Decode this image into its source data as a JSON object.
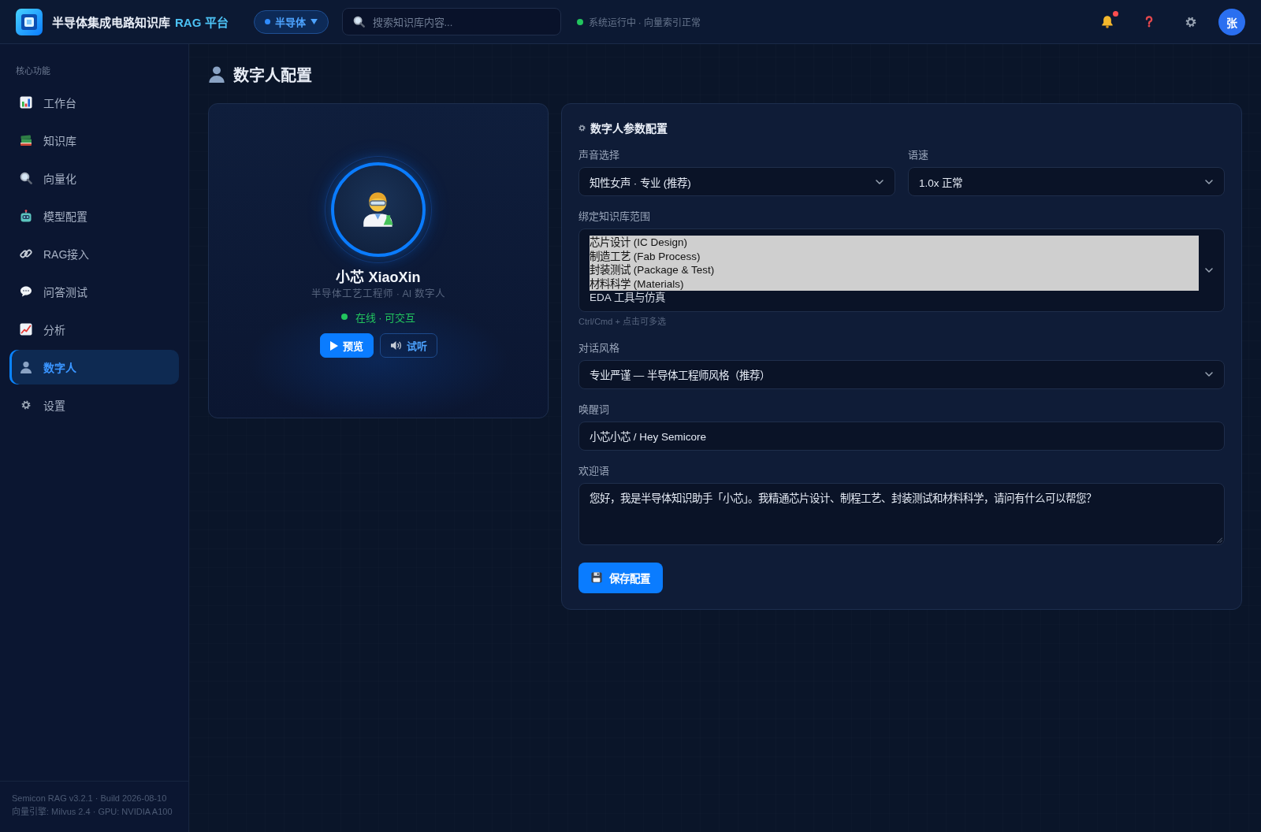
{
  "topbar": {
    "brand": {
      "name": "半导体集成电路知识库",
      "accent": "RAG 平台"
    },
    "domain": {
      "label": "半导体"
    },
    "search": {
      "placeholder": "搜索知识库内容..."
    },
    "status": {
      "ok": true,
      "text": "系统运行中 · 向量索引正常"
    },
    "notifications": {
      "unread": true
    },
    "user": {
      "initial": "张"
    }
  },
  "sidebar": {
    "section": "核心功能",
    "items": [
      {
        "label": "工作台",
        "selected": false
      },
      {
        "label": "知识库",
        "selected": false
      },
      {
        "label": "向量化",
        "selected": false
      },
      {
        "label": "模型配置",
        "selected": false
      },
      {
        "label": "RAG接入",
        "selected": false
      },
      {
        "label": "问答测试",
        "selected": false
      },
      {
        "label": "分析",
        "selected": false
      },
      {
        "label": "数字人",
        "selected": true
      },
      {
        "label": "设置",
        "selected": false
      }
    ],
    "footer": [
      "Semicon RAG v3.2.1 · Build 2026-08-10",
      "向量引擎: Milvus 2.4 · GPU: NVIDIA A100"
    ]
  },
  "page": {
    "title": "数字人配置"
  },
  "avatar_card": {
    "name": "小芯 XiaoXin",
    "role": "半导体工艺工程师 · AI 数字人",
    "status": {
      "online": true,
      "text": "在线 · 可交互"
    },
    "buttons": [
      {
        "label": "预览",
        "kind": "primary"
      },
      {
        "label": "试听",
        "kind": "outline"
      }
    ]
  },
  "config": {
    "title": "数字人参数配置",
    "rows": [
      [
        {
          "kind": "select",
          "label": "声音选择",
          "value": "知性女声 · 专业 (推荐)"
        },
        {
          "kind": "select",
          "label": "语速",
          "value": "1.0x 正常"
        }
      ],
      [
        {
          "kind": "multiselect",
          "label": "绑定知识库范围",
          "options": [
            {
              "label": "芯片设计 (IC Design)",
              "selected": true
            },
            {
              "label": "制造工艺 (Fab Process)",
              "selected": true
            },
            {
              "label": "封装测试 (Package & Test)",
              "selected": true
            },
            {
              "label": "材料科学 (Materials)",
              "selected": true
            },
            {
              "label": "EDA 工具与仿真",
              "selected": false
            }
          ],
          "hint": "Ctrl/Cmd + 点击可多选"
        }
      ],
      [
        {
          "kind": "select",
          "label": "对话风格",
          "value": "专业严谨 — 半导体工程师风格（推荐）"
        }
      ],
      [
        {
          "kind": "input",
          "label": "唤醒词",
          "value": "小芯小芯 / Hey Semicore"
        }
      ],
      [
        {
          "kind": "textarea",
          "label": "欢迎语",
          "value": "您好，我是半导体知识助手「小芯」。我精通芯片设计、制程工艺、封装测试和材料科学，请问有什么可以帮您？"
        }
      ]
    ],
    "save_button": "保存配置"
  }
}
